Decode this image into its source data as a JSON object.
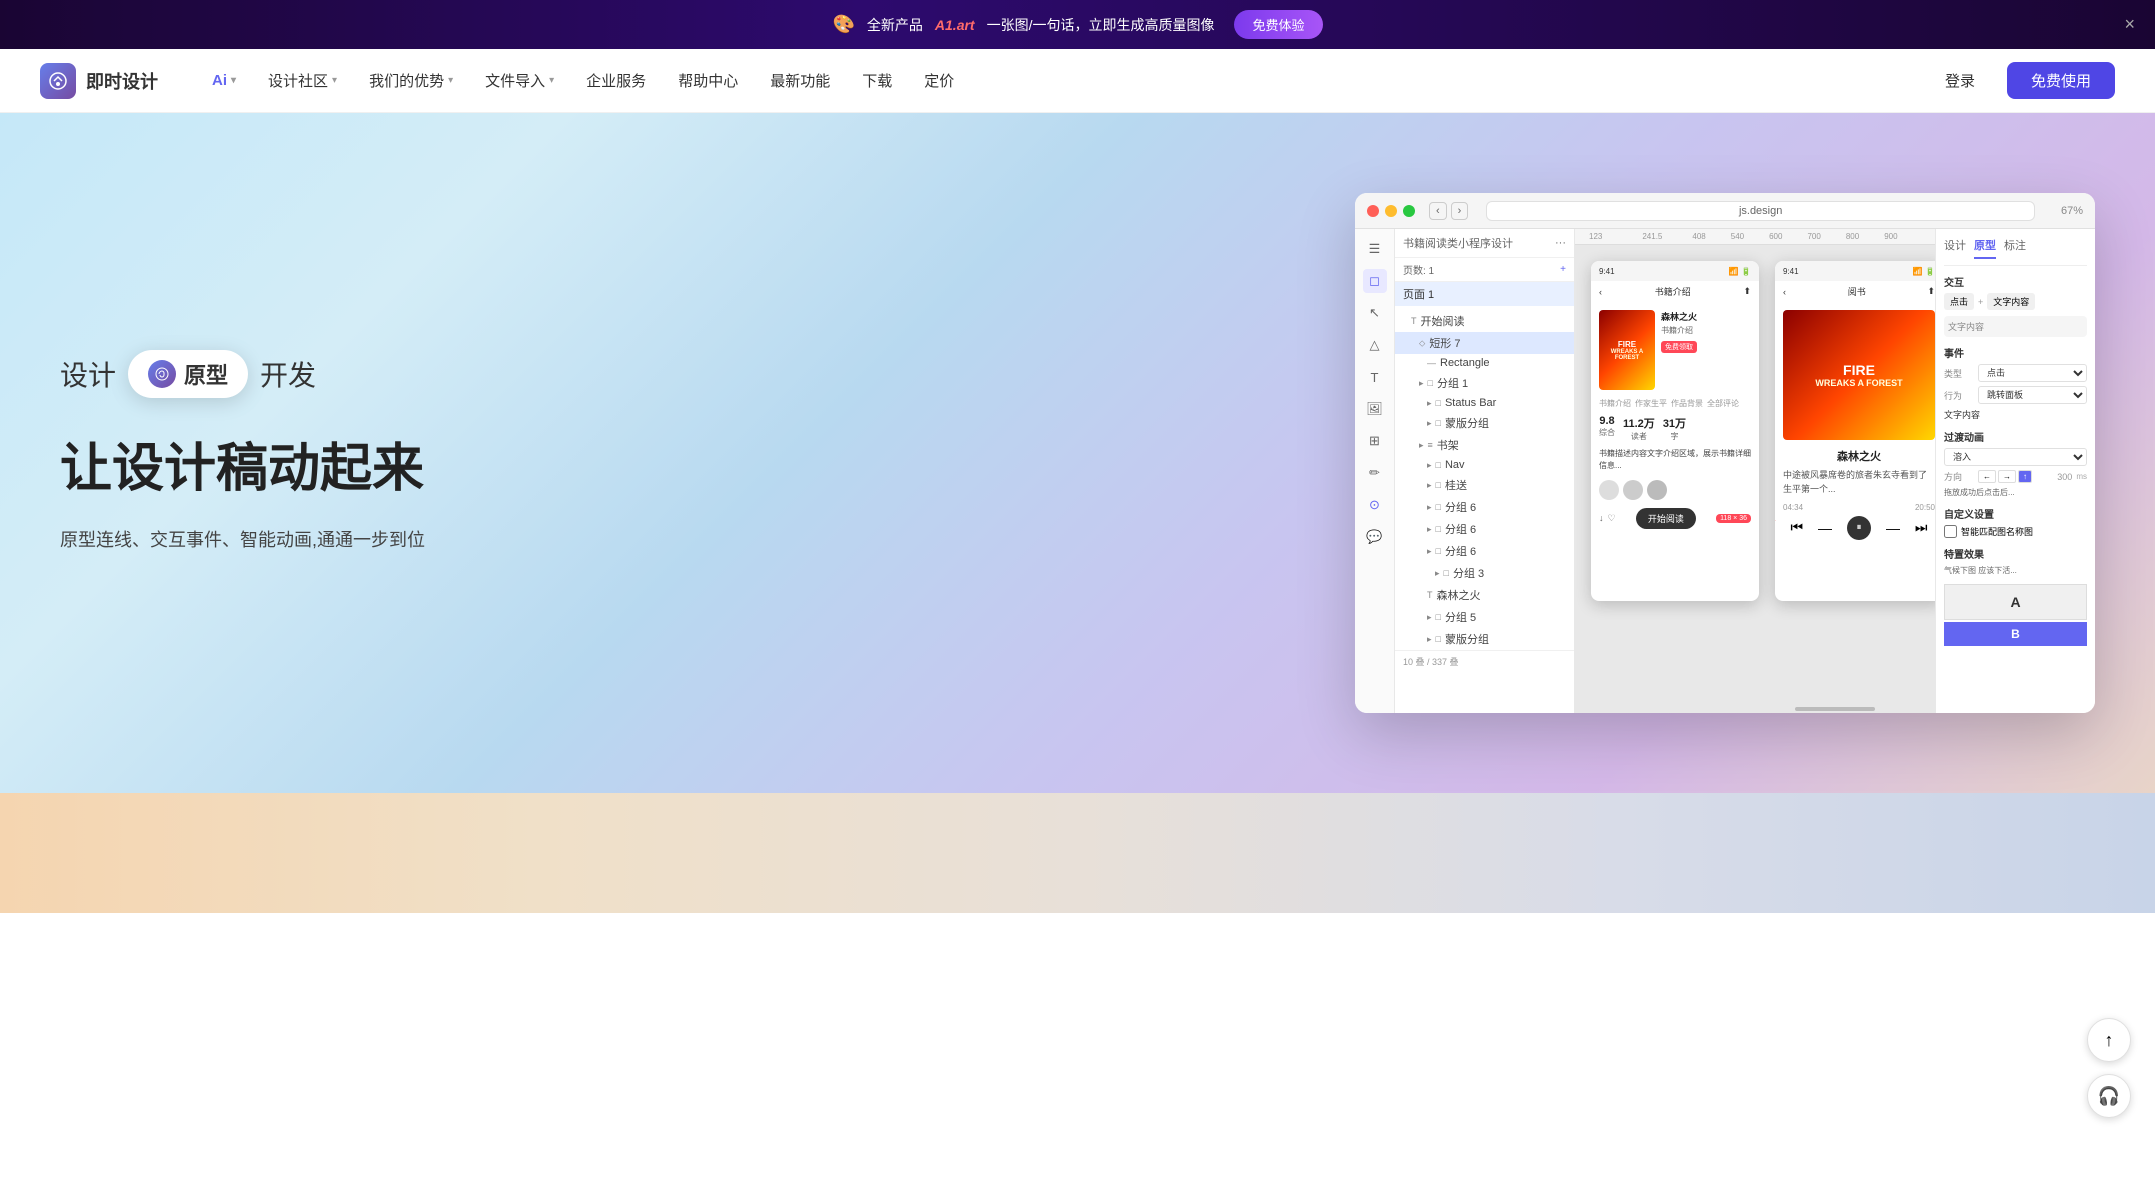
{
  "banner": {
    "emoji": "🎨",
    "prefix": "全新产品",
    "brand": "A1.art",
    "separator": "一张图/一句话，立即生成高质量图像",
    "cta_label": "免费体验",
    "close_label": "×"
  },
  "header": {
    "logo_text": "即时设计",
    "nav_items": [
      {
        "label": "Ai",
        "has_chevron": true,
        "is_ai": true
      },
      {
        "label": "设计社区",
        "has_chevron": true,
        "is_ai": false
      },
      {
        "label": "我们的优势",
        "has_chevron": true,
        "is_ai": false
      },
      {
        "label": "文件导入",
        "has_chevron": true,
        "is_ai": false
      },
      {
        "label": "企业服务",
        "has_chevron": false,
        "is_ai": false
      },
      {
        "label": "帮助中心",
        "has_chevron": false,
        "is_ai": false
      },
      {
        "label": "最新功能",
        "has_chevron": false,
        "is_ai": false
      },
      {
        "label": "下载",
        "has_chevron": false,
        "is_ai": false
      },
      {
        "label": "定价",
        "has_chevron": false,
        "is_ai": false
      }
    ],
    "login_label": "登录",
    "free_label": "免费使用"
  },
  "hero": {
    "tag_design": "设计",
    "tag_badge": "原型",
    "tag_dev": "开发",
    "main_title": "让设计稿动起来",
    "description": "原型连线、交互事件、智能动画,通通一步到位",
    "app_url": "js.design"
  },
  "app": {
    "toolbar_zoom": "67%",
    "page_label": "页面 1",
    "layers": [
      {
        "label": "开始阅读",
        "indent": 1,
        "icon": "T"
      },
      {
        "label": "短形 7",
        "indent": 1,
        "icon": "◇",
        "selected": true
      },
      {
        "label": "Rectangle",
        "indent": 2,
        "icon": "—"
      },
      {
        "label": "分组 1",
        "indent": 1,
        "icon": "□"
      },
      {
        "label": "Status Bar",
        "indent": 2,
        "icon": "□"
      },
      {
        "label": "蒙版分组",
        "indent": 2,
        "icon": "□"
      },
      {
        "label": "书架",
        "indent": 1,
        "icon": "≡"
      },
      {
        "label": "Nav",
        "indent": 2,
        "icon": "□"
      },
      {
        "label": "桂送",
        "indent": 2,
        "icon": "□"
      },
      {
        "label": "分组 6",
        "indent": 2,
        "icon": "□"
      },
      {
        "label": "分组 6",
        "indent": 2,
        "icon": "□"
      },
      {
        "label": "分组 6",
        "indent": 2,
        "icon": "□"
      },
      {
        "label": "分组 3",
        "indent": 3,
        "icon": "□"
      },
      {
        "label": "森林之火",
        "indent": 2,
        "icon": "T"
      },
      {
        "label": "分组 5",
        "indent": 2,
        "icon": "□"
      },
      {
        "label": "蒙版分组",
        "indent": 2,
        "icon": "□"
      }
    ],
    "props_tabs": [
      "设计",
      "原型",
      "标注"
    ],
    "active_tab": "原型",
    "book_title": "森林之火",
    "annotation": "118 × 36"
  },
  "fab": {
    "scroll_top_icon": "↑",
    "headphone_icon": "🎧"
  }
}
